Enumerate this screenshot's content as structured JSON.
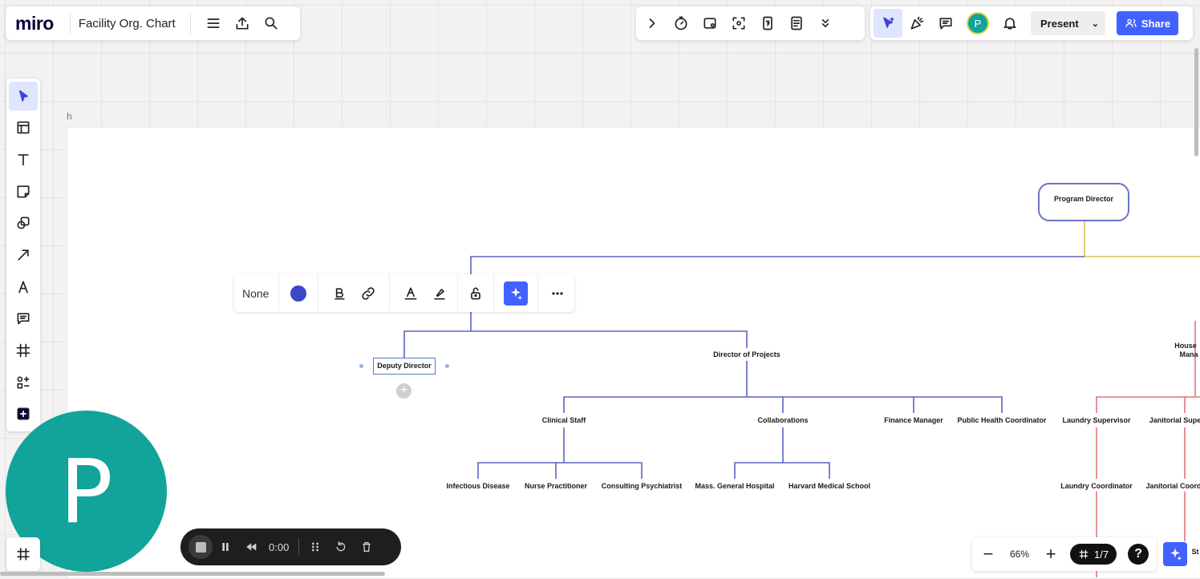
{
  "app": {
    "logo": "miro",
    "board_title": "Facility Org. Chart"
  },
  "top_right": {
    "present_label": "Present",
    "share_label": "Share",
    "avatar_initial": "P"
  },
  "frame": {
    "title": "h"
  },
  "context_toolbar": {
    "fill_label": "None"
  },
  "org_chart": {
    "program_director": "Program Director",
    "deputy_director": "Deputy Director",
    "director_of_projects": "Director of Projects",
    "clinical_staff": "Clinical Staff",
    "collaborations": "Collaborations",
    "finance_manager": "Finance Manager",
    "public_health_coordinator": "Public Health Coordinator",
    "infectious_disease": "Infectious Disease",
    "nurse_practitioner": "Nurse Practitioner",
    "consulting_psychiatrist": "Consulting Psychiatrist",
    "mass_general": "Mass. General Hospital",
    "harvard": "Harvard Medical School",
    "housekeeping_partial": "House",
    "housekeeping_partial2": "Mana",
    "laundry_supervisor": "Laundry Supervisor",
    "janitorial_supervisor_partial": "Janitorial Supe",
    "laundry_coordinator": "Laundry Coordinator",
    "janitorial_coordinator_partial": "Janitorial Coord",
    "partial_st": "St"
  },
  "recording": {
    "time": "0:00"
  },
  "presenter": {
    "initial": "P"
  },
  "zoom": {
    "value": "66%",
    "pages": "1/7",
    "help": "?"
  },
  "colors": {
    "accent": "#4262ff",
    "connector_blue": "#5b63c4",
    "connector_yellow": "#e2c04f",
    "connector_red": "#e0747e",
    "avatar": "#12a39a"
  }
}
